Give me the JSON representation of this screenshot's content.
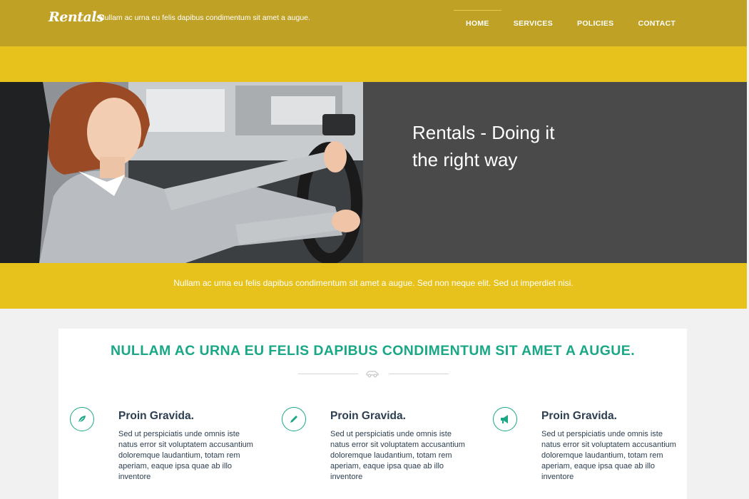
{
  "header": {
    "logo": "Rentals",
    "tagline": "Nullam ac urna eu felis dapibus condimentum sit amet a augue.",
    "nav": [
      {
        "label": "HOME",
        "active": true
      },
      {
        "label": "SERVICES"
      },
      {
        "label": "POLICIES"
      },
      {
        "label": "CONTACT"
      }
    ]
  },
  "hero": {
    "title": "Rentals - Doing it the right way",
    "image_icon": "woman-driving-car-photo"
  },
  "strip": {
    "text": "Nullam ac urna eu felis dapibus condimentum sit amet a augue. Sed non neque elit. Sed ut imperdiet nisi."
  },
  "section": {
    "heading": "NULLAM AC URNA EU FELIS DAPIBUS CONDIMENTUM SIT AMET A AUGUE.",
    "divider_icon": "car-icon"
  },
  "features": [
    {
      "icon": "leaf-icon",
      "title": "Proin Gravida.",
      "text": "Sed ut perspiciatis unde omnis iste natus error sit voluptatem accusantium doloremque laudantium, totam rem aperiam, eaque ipsa quae ab illo inventore"
    },
    {
      "icon": "pencil-icon",
      "title": "Proin Gravida.",
      "text": "Sed ut perspiciatis unde omnis iste natus error sit voluptatem accusantium doloremque laudantium, totam rem aperiam, eaque ipsa quae ab illo inventore"
    },
    {
      "icon": "megaphone-icon",
      "title": "Proin Gravida.",
      "text": "Sed ut perspiciatis unde omnis iste natus error sit voluptatem accusantium doloremque laudantium, totam rem aperiam, eaque ipsa quae ab illo inventore"
    }
  ],
  "colors": {
    "header": "#bfa126",
    "yellow": "#e8c21c",
    "dark_panel": "#4a4a4a",
    "accent_green": "#19a786",
    "text_dark": "#2c3e50"
  }
}
